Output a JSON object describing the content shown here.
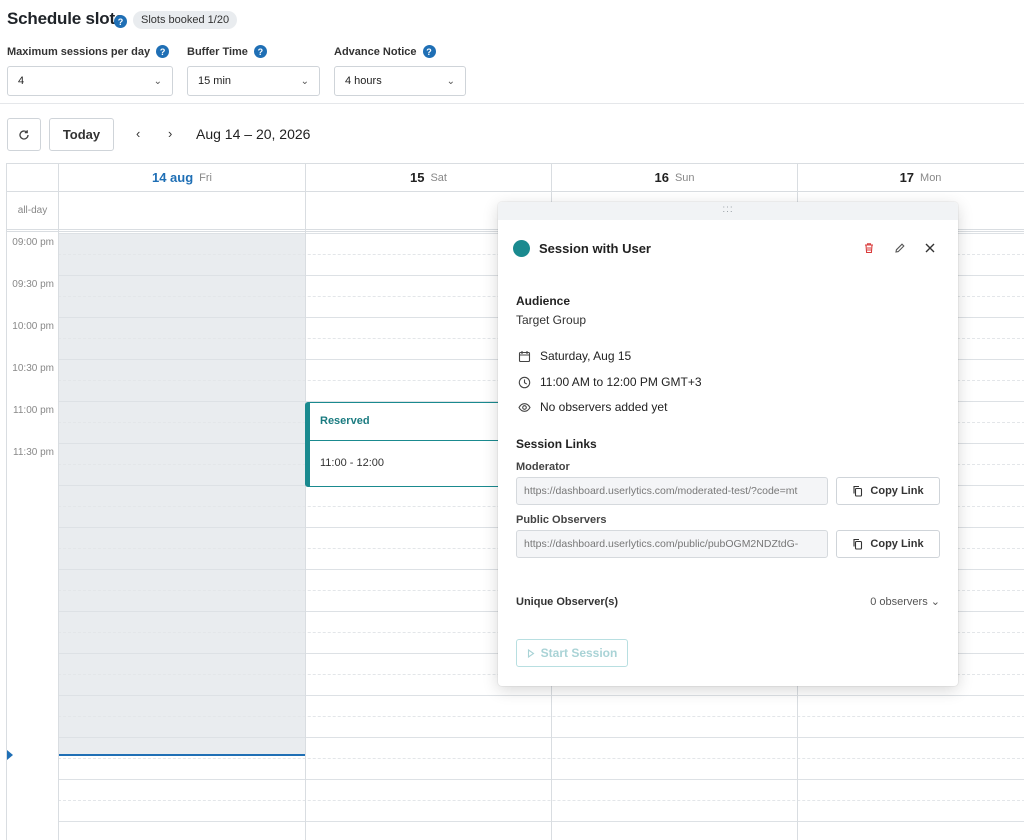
{
  "header": {
    "title": "Schedule slots",
    "help_icon": "?",
    "badge": "Slots booked 1/20"
  },
  "settings": {
    "max_sessions": {
      "label": "Maximum sessions per day",
      "value": "4"
    },
    "buffer_time": {
      "label": "Buffer Time",
      "value": "15 min"
    },
    "advance_notice": {
      "label": "Advance Notice",
      "value": "4 hours"
    }
  },
  "toolbar": {
    "refresh_icon": "refresh-icon",
    "today_label": "Today",
    "prev_label": "‹",
    "next_label": "›",
    "date_range": "Aug 14 – 20, 2026"
  },
  "calendar": {
    "days": [
      {
        "num": "14 aug",
        "weekday": "Fri",
        "today": true
      },
      {
        "num": "15",
        "weekday": "Sat",
        "today": false
      },
      {
        "num": "16",
        "weekday": "Sun",
        "today": false
      },
      {
        "num": "17",
        "weekday": "Mon",
        "today": false
      }
    ],
    "allday_label": "all-day",
    "times": [
      "09:00 pm",
      "09:30 pm",
      "10:00 pm",
      "10:30 pm",
      "11:00 pm",
      "11:30 pm"
    ],
    "event": {
      "title": "Reserved",
      "time": "11:00 - 12:00"
    }
  },
  "popover": {
    "grip": ":::",
    "title": "Session with User",
    "audience_label": "Audience",
    "audience_value": "Target Group",
    "date": "Saturday, Aug 15",
    "time": "11:00 AM to 12:00 PM GMT+3",
    "observers_note": "No observers added yet",
    "links_title": "Session Links",
    "moderator_label": "Moderator",
    "moderator_url": "https://dashboard.userlytics.com/moderated-test/?code=mt",
    "public_label": "Public Observers",
    "public_url": "https://dashboard.userlytics.com/public/pubOGM2NDZtdG-",
    "copy_label": "Copy Link",
    "unique_label": "Unique Observer(s)",
    "observer_count": "0 observers",
    "start_label": "Start Session"
  },
  "colors": {
    "accent": "#1f6fb5",
    "event": "#1a8a8f",
    "danger": "#d93a3a"
  }
}
